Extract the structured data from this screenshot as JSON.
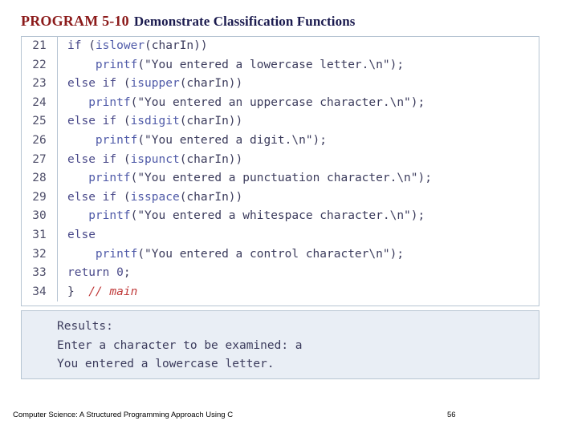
{
  "title": {
    "prefix": "PROGRAM 5-10",
    "text": "Demonstrate Classification Functions",
    "prefix_color": "#8b1a1a",
    "text_color": "#1a1a4e"
  },
  "code": {
    "line_numbers": [
      "21",
      "22",
      "23",
      "24",
      "25",
      "26",
      "27",
      "28",
      "29",
      "30",
      "31",
      "32",
      "33",
      "34"
    ],
    "lines": [
      "    if (islower(charIn))",
      "        printf(\"You entered a lowercase letter.\\n\");",
      "    else if (isupper(charIn))",
      "        printf(\"You entered an uppercase character.\\n\");",
      "    else if (isdigit(charIn))",
      "        printf(\"You entered a digit.\\n\");",
      "    else if (ispunct(charIn))",
      "        printf(\"You entered a punctuation character.\\n\");",
      "    else if (isspace(charIn))",
      "        printf(\"You entered a whitespace character.\\n\");",
      "    else",
      "        printf(\"You entered a control character\\n\");",
      "    return 0;",
      "}  // main"
    ]
  },
  "results": {
    "heading": "Results:",
    "lines": [
      "Enter a character to be examined: a",
      "You entered a lowercase letter."
    ]
  },
  "footer": {
    "source": "Computer Science: A Structured Programming Approach Using C",
    "page": "56"
  }
}
